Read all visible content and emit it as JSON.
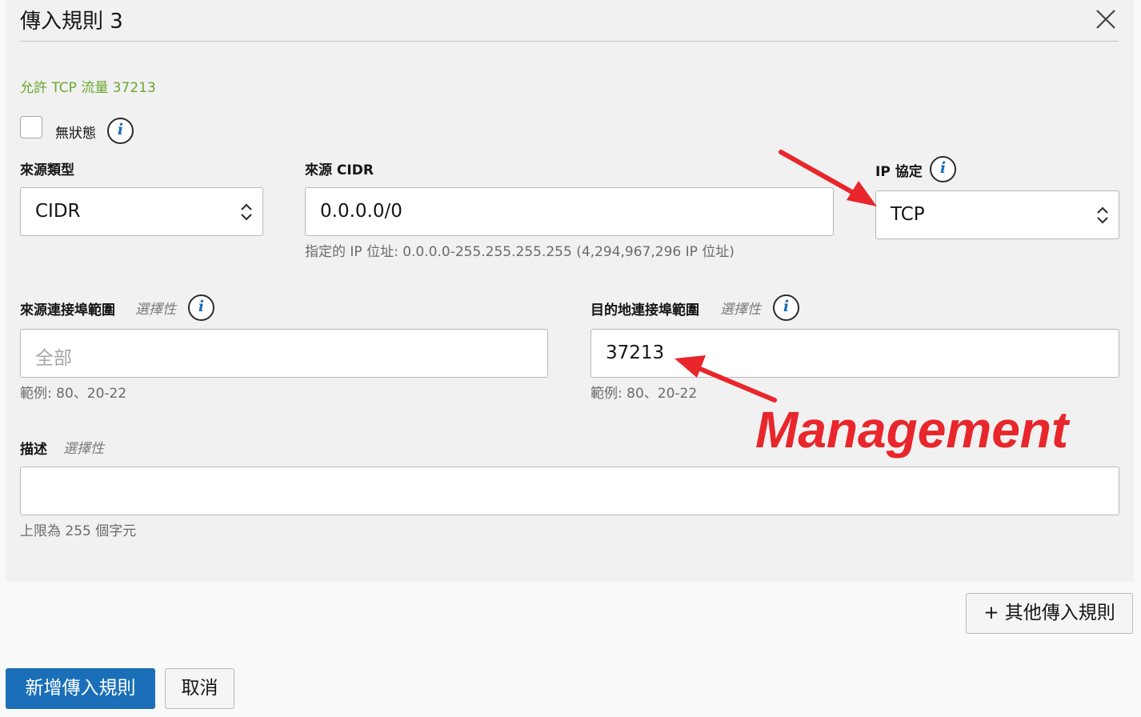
{
  "dialog": {
    "title": "傳入規則 3",
    "close_icon": "close-icon",
    "subtitle": "允許 TCP 流量 37213"
  },
  "stateless": {
    "label": "無狀態",
    "checked": false,
    "info_glyph": "i"
  },
  "source_type": {
    "label": "來源類型",
    "value": "CIDR"
  },
  "source_cidr": {
    "label": "來源 CIDR",
    "value": "0.0.0.0/0",
    "hint": "指定的 IP 位址: 0.0.0.0-255.255.255.255 (4,294,967,296 IP 位址)"
  },
  "ip_protocol": {
    "label": "IP 協定",
    "value": "TCP",
    "info_glyph": "i"
  },
  "source_port": {
    "label": "來源連接埠範圍",
    "optional": "選擇性",
    "placeholder": "全部",
    "hint": "範例: 80、20-22",
    "info_glyph": "i"
  },
  "dest_port": {
    "label": "目的地連接埠範圍",
    "optional": "選擇性",
    "value": "37213",
    "hint": "範例: 80、20-22",
    "info_glyph": "i"
  },
  "description": {
    "label": "描述",
    "optional": "選擇性",
    "value": "",
    "hint": "上限為 255 個字元"
  },
  "buttons": {
    "add_more": "+ 其他傳入規則",
    "submit": "新增傳入規則",
    "cancel": "取消"
  },
  "annotation": {
    "text": "Management",
    "color": "#e8262b"
  },
  "colors": {
    "primary": "#1b6fb8",
    "subtitle_green": "#6aa832",
    "info_icon": "#1b6fb8"
  }
}
